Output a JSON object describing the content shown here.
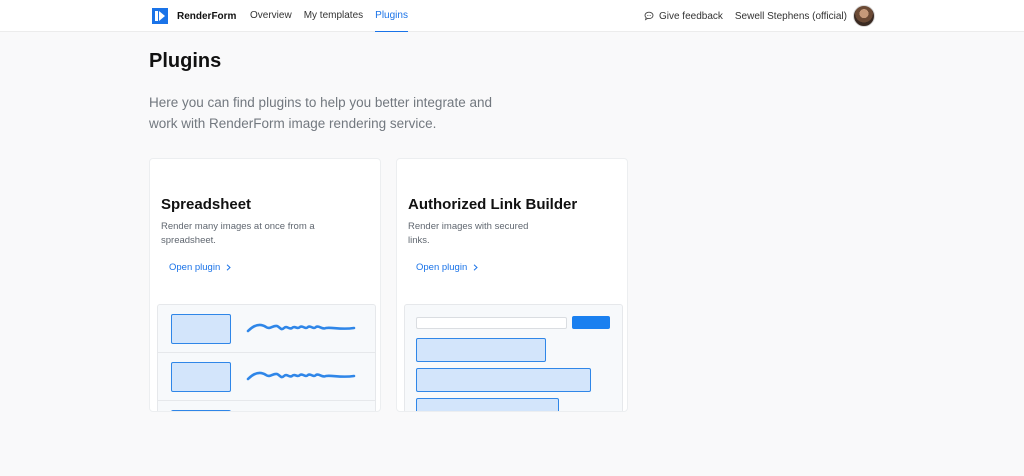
{
  "brand": {
    "name": "RenderForm",
    "icon": "renderform-logo-icon",
    "color": "#1a73e8"
  },
  "nav": [
    {
      "label": "Overview",
      "active": false
    },
    {
      "label": "My templates",
      "active": false
    },
    {
      "label": "Plugins",
      "active": true
    }
  ],
  "header": {
    "feedback_label": "Give feedback",
    "feedback_icon": "chat-bubble-icon",
    "user_name": "Sewell Stephens (official)"
  },
  "page": {
    "title": "Plugins",
    "description": "Here you can find plugins to help you better integrate and work with RenderForm image rendering service."
  },
  "plugins": [
    {
      "title": "Spreadsheet",
      "description": "Render many images at once from a spreadsheet.",
      "link_label": "Open plugin",
      "link_icon": "chevron-right-icon"
    },
    {
      "title": "Authorized Link Builder",
      "description": "Render images with secured links.",
      "link_label": "Open plugin",
      "link_icon": "chevron-right-icon"
    }
  ],
  "colors": {
    "accent": "#1a73e8",
    "illustration_fill": "#d3e5fb",
    "illustration_stroke": "#2f86e8"
  }
}
